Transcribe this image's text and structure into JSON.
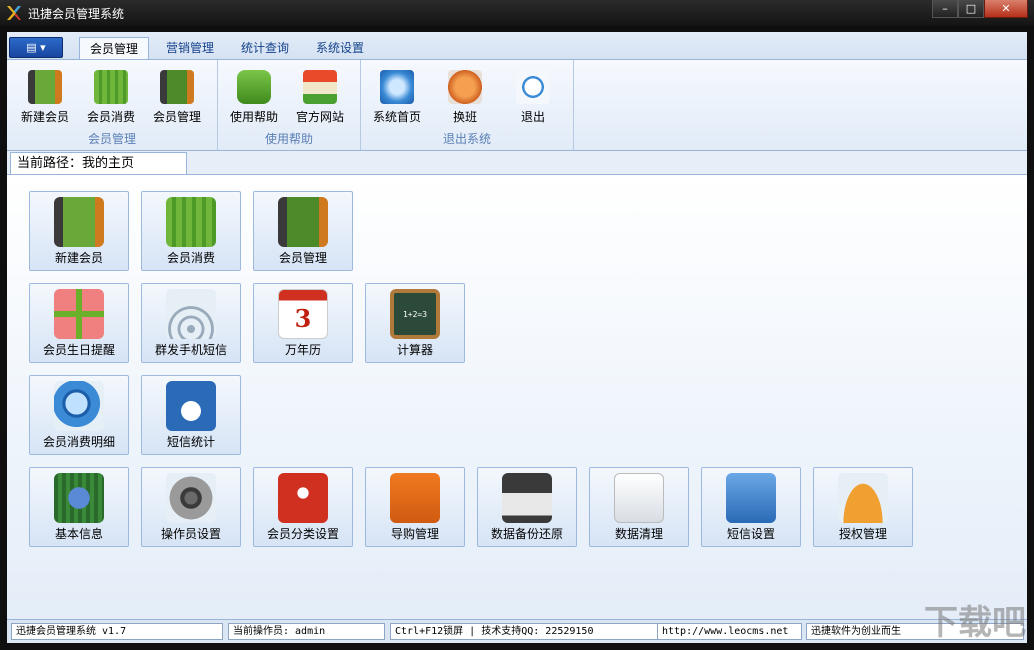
{
  "window": {
    "title": "迅捷会员管理系统",
    "minimize": "–",
    "maximize": "□",
    "close": "✕"
  },
  "menu": {
    "app_button": "▤ ▾",
    "tabs": [
      "会员管理",
      "营销管理",
      "统计查询",
      "系统设置"
    ]
  },
  "ribbon": {
    "groups": [
      {
        "label": "会员管理",
        "buttons": [
          {
            "label": "新建会员",
            "icon": "contact-book-icon"
          },
          {
            "label": "会员消费",
            "icon": "water-drop-icon"
          },
          {
            "label": "会员管理",
            "icon": "address-book-icon"
          }
        ]
      },
      {
        "label": "使用帮助",
        "buttons": [
          {
            "label": "使用帮助",
            "icon": "speech-bubble-icon"
          },
          {
            "label": "官方网站",
            "icon": "shop-icon"
          }
        ]
      },
      {
        "label": "退出系统",
        "buttons": [
          {
            "label": "系统首页",
            "icon": "compass-icon"
          },
          {
            "label": "换班",
            "icon": "swap-icon"
          },
          {
            "label": "退出",
            "icon": "power-icon"
          }
        ]
      }
    ]
  },
  "path": {
    "text": "当前路径：我的主页"
  },
  "tiles": {
    "row1": [
      {
        "label": "新建会员",
        "icon": "contact-book-icon"
      },
      {
        "label": "会员消费",
        "icon": "water-drop-icon"
      },
      {
        "label": "会员管理",
        "icon": "address-book-icon"
      }
    ],
    "row2": [
      {
        "label": "会员生日提醒",
        "icon": "gift-icon"
      },
      {
        "label": "群发手机短信",
        "icon": "wifi-icon"
      },
      {
        "label": "万年历",
        "icon": "calendar-icon",
        "glyph": "3"
      },
      {
        "label": "计算器",
        "icon": "chalkboard-icon",
        "glyph": "1+2=3"
      }
    ],
    "row3": [
      {
        "label": "会员消费明细",
        "icon": "magnifier-icon"
      },
      {
        "label": "短信统计",
        "icon": "mail-icon"
      }
    ],
    "row4": [
      {
        "label": "基本信息",
        "icon": "circuit-board-icon"
      },
      {
        "label": "操作员设置",
        "icon": "dpad-icon"
      },
      {
        "label": "会员分类设置",
        "icon": "puzzle-icon"
      },
      {
        "label": "导购管理",
        "icon": "org-chart-icon"
      },
      {
        "label": "数据备份还原",
        "icon": "floppy-icon"
      },
      {
        "label": "数据清理",
        "icon": "cart-icon"
      },
      {
        "label": "短信设置",
        "icon": "envelope-icon"
      },
      {
        "label": "授权管理",
        "icon": "umbrella-icon"
      }
    ]
  },
  "status": {
    "app": "迅捷会员管理系统 v1.7",
    "operator": "当前操作员: admin",
    "support": "Ctrl+F12锁屏 | 技术支持QQ: 22529150",
    "url": "http://www.leocms.net",
    "slogan": "迅捷软件为创业而生"
  },
  "watermark": "下载吧"
}
